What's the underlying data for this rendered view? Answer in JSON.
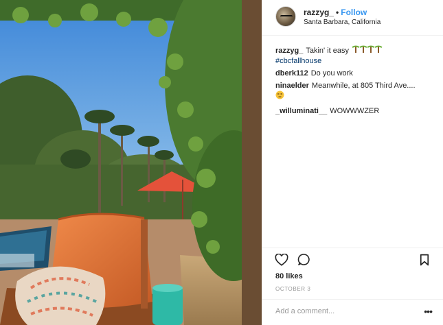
{
  "post": {
    "username": "razzyg_",
    "separator": "•",
    "follow_label": "Follow",
    "location": "Santa Barbara, California",
    "photo_icon": "backyard-pool-palm-trees-photo"
  },
  "comments": [
    {
      "user": "razzyg_",
      "text": "Takin' it easy",
      "emoji": "palm-trees-emoji",
      "hashtag": "#cbcfallhouse"
    },
    {
      "user": "dberk112",
      "text": "Do you work"
    },
    {
      "user": "ninaelder",
      "text": "Meanwhile, at 805 Third Ave....",
      "emoji": "unamused-face-emoji"
    },
    {
      "user": "_willuminati__",
      "text": "WOWWWZER"
    }
  ],
  "actions": {
    "like_icon": "heart-icon",
    "comment_icon": "comment-bubble-icon",
    "save_icon": "bookmark-icon",
    "likes": "80 likes",
    "date": "OCTOBER 3"
  },
  "add_comment": {
    "placeholder": "Add a comment...",
    "more_label": "•••"
  },
  "colors": {
    "follow": "#3897f0",
    "hashtag": "#003569",
    "border": "#efefef",
    "muted": "#999999"
  }
}
